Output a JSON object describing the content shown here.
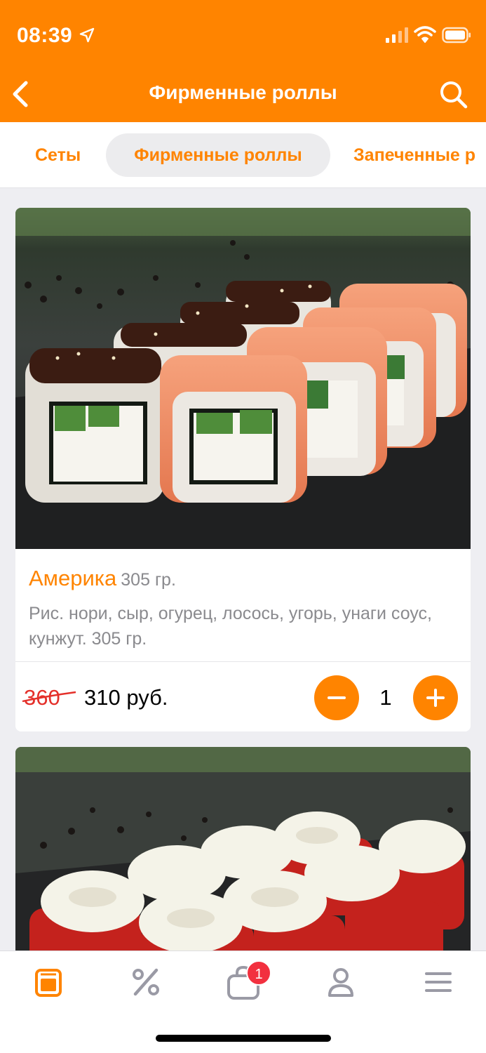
{
  "status_bar": {
    "time": "08:39"
  },
  "header": {
    "title": "Фирменные роллы",
    "back_icon": "chevron-left-icon",
    "search_icon": "search-icon"
  },
  "tabs": [
    {
      "label": "Сеты",
      "active": false
    },
    {
      "label": "Фирменные роллы",
      "active": true
    },
    {
      "label": "Запеченные р",
      "active": false
    }
  ],
  "products": [
    {
      "name": "Америка",
      "weight": "305 гр.",
      "description": "Рис. нори, сыр, огурец, лосось, угорь, унаги соус, кунжут. 305 гр.",
      "old_price": "360",
      "price": "310 руб.",
      "quantity": "1"
    }
  ],
  "tab_bar": {
    "items": [
      {
        "icon": "menu-book-icon",
        "active": true
      },
      {
        "icon": "percent-icon",
        "active": false
      },
      {
        "icon": "cart-icon",
        "active": false,
        "badge": "1"
      },
      {
        "icon": "profile-icon",
        "active": false
      },
      {
        "icon": "hamburger-menu-icon",
        "active": false
      }
    ]
  },
  "colors": {
    "accent": "#ff8400",
    "badge": "#f2303f",
    "old_price": "#e4302a"
  }
}
